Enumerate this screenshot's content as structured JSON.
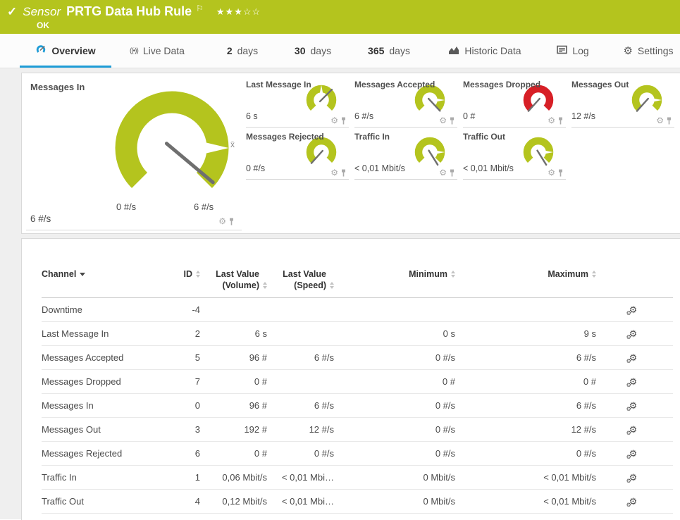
{
  "colors": {
    "brand_green": "#b4c41e",
    "alert_red": "#d71f26",
    "accent_blue": "#1e9cd6",
    "needle_gray": "#6f6f6f"
  },
  "header": {
    "type_label": "Sensor",
    "title": "PRTG Data Hub Rule",
    "status": "OK",
    "rating": {
      "filled": 3,
      "total": 5
    }
  },
  "tabs": [
    {
      "id": "overview",
      "icon": "gauge-icon",
      "label": "Overview",
      "active": true
    },
    {
      "id": "live-data",
      "icon": "live-data-icon",
      "label": "Live Data",
      "active": false
    },
    {
      "id": "2-days",
      "prefix": "2",
      "label": "days",
      "active": false
    },
    {
      "id": "30-days",
      "prefix": "30",
      "label": "days",
      "active": false
    },
    {
      "id": "365-days",
      "prefix": "365",
      "label": "days",
      "active": false
    },
    {
      "id": "historic-data",
      "icon": "historic-data-icon",
      "label": "Historic Data",
      "active": false
    },
    {
      "id": "log",
      "icon": "log-icon",
      "label": "Log",
      "active": false
    },
    {
      "id": "settings",
      "icon": "settings-gear-icon",
      "label": "Settings",
      "active": false
    }
  ],
  "gauges": {
    "main": {
      "label": "Messages In",
      "value": "6 #/s",
      "scale_min": "0 #/s",
      "scale_max": "6 #/s",
      "color": "green",
      "needle_deg": 130,
      "avg_marker_deg": 90,
      "avg_marker_label": "x̄"
    },
    "small": [
      {
        "label": "Last Message In",
        "value": "6 s",
        "color": "green",
        "needle_deg": 45,
        "avg_marker_deg": 0
      },
      {
        "label": "Messages Accepted",
        "value": "6 #/s",
        "color": "green",
        "needle_deg": 137,
        "avg_marker_deg": 90
      },
      {
        "label": "Messages Dropped",
        "value": "0 #",
        "color": "red",
        "needle_deg": 222,
        "avg_marker_deg": null
      },
      {
        "label": "Messages Out",
        "value": "12 #/s",
        "color": "green",
        "needle_deg": 222,
        "avg_marker_deg": 90
      },
      {
        "label": "Messages Rejected",
        "value": "0 #/s",
        "color": "green",
        "needle_deg": 222,
        "avg_marker_deg": null
      },
      {
        "label": "Traffic In",
        "value": "< 0,01 Mbit/s",
        "color": "green",
        "needle_deg": 148,
        "avg_marker_deg": 90
      },
      {
        "label": "Traffic Out",
        "value": "< 0,01 Mbit/s",
        "color": "green",
        "needle_deg": 148,
        "avg_marker_deg": 90
      }
    ]
  },
  "table": {
    "columns": [
      {
        "key": "channel",
        "line1": "Channel",
        "line2": "",
        "sort": "desc",
        "align": "left"
      },
      {
        "key": "id",
        "line1": "ID",
        "line2": "",
        "sort": "both",
        "align": "right"
      },
      {
        "key": "vol",
        "line1": "Last Value",
        "line2": "(Volume)",
        "sort": "both",
        "align": "right"
      },
      {
        "key": "speed",
        "line1": "Last Value",
        "line2": "(Speed)",
        "sort": "both",
        "align": "right"
      },
      {
        "key": "min",
        "line1": "Minimum",
        "line2": "",
        "sort": "both",
        "align": "right"
      },
      {
        "key": "max",
        "line1": "Maximum",
        "line2": "",
        "sort": "both",
        "align": "right"
      },
      {
        "key": "actions",
        "line1": "",
        "line2": "",
        "sort": "none",
        "align": "center"
      }
    ],
    "rows": [
      {
        "channel": "Downtime",
        "id": "-4",
        "vol": "",
        "speed": "",
        "min": "",
        "max": ""
      },
      {
        "channel": "Last Message In",
        "id": "2",
        "vol": "6 s",
        "speed": "",
        "min": "0 s",
        "max": "9 s"
      },
      {
        "channel": "Messages Accepted",
        "id": "5",
        "vol": "96 #",
        "speed": "6 #/s",
        "min": "0 #/s",
        "max": "6 #/s"
      },
      {
        "channel": "Messages Dropped",
        "id": "7",
        "vol": "0 #",
        "speed": "",
        "min": "0 #",
        "max": "0 #"
      },
      {
        "channel": "Messages In",
        "id": "0",
        "vol": "96 #",
        "speed": "6 #/s",
        "min": "0 #/s",
        "max": "6 #/s"
      },
      {
        "channel": "Messages Out",
        "id": "3",
        "vol": "192 #",
        "speed": "12 #/s",
        "min": "0 #/s",
        "max": "12 #/s"
      },
      {
        "channel": "Messages Rejected",
        "id": "6",
        "vol": "0 #",
        "speed": "0 #/s",
        "min": "0 #/s",
        "max": "0 #/s"
      },
      {
        "channel": "Traffic In",
        "id": "1",
        "vol": "0,06 Mbit/s",
        "speed": "< 0,01 Mbi…",
        "min": "0 Mbit/s",
        "max": "< 0,01 Mbit/s"
      },
      {
        "channel": "Traffic Out",
        "id": "4",
        "vol": "0,12 Mbit/s",
        "speed": "< 0,01 Mbi…",
        "min": "0 Mbit/s",
        "max": "< 0,01 Mbit/s"
      }
    ]
  }
}
